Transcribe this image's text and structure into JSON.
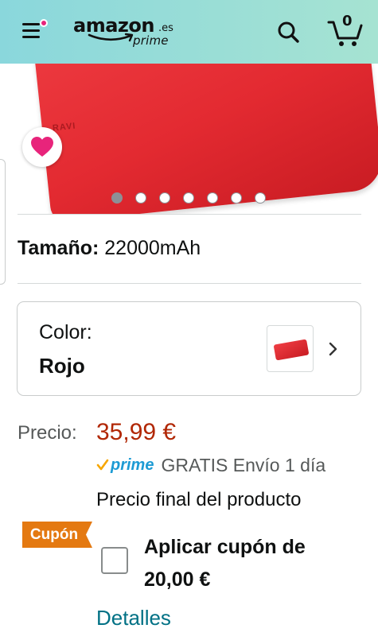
{
  "header": {
    "logo_word": "amazon",
    "logo_tld": ".es",
    "logo_prime": "prime",
    "cart_count": "0",
    "icons": [
      "menu-icon",
      "search-icon",
      "cart-icon"
    ],
    "brand_color": "#8ad7dc"
  },
  "gallery": {
    "image_count": 7,
    "active_index": 0,
    "product_mark": "RAVI",
    "wishlist_icon": "heart-icon",
    "heart_color": "#e8247b"
  },
  "size": {
    "label": "Tamaño:",
    "value": "22000mAh"
  },
  "color": {
    "label": "Color:",
    "value": "Rojo"
  },
  "price": {
    "label": "Precio:",
    "value": "35,99 €",
    "color": "#b12704"
  },
  "prime": {
    "badge": "prime",
    "shipping": "GRATIS Envío 1 día"
  },
  "final_price_text": "Precio final del producto",
  "coupon": {
    "badge": "Cupón",
    "badge_color": "#e47911",
    "text": "Aplicar cupón de 20,00 €",
    "checked": false
  },
  "details_link": "Detalles"
}
